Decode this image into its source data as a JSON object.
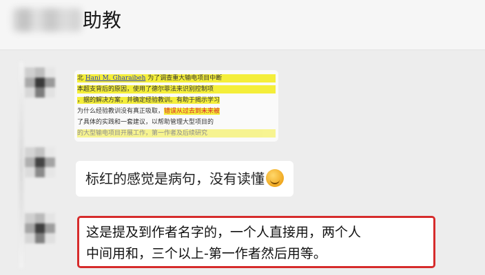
{
  "header": {
    "title_suffix": "助教"
  },
  "messages": [
    {
      "type": "image",
      "doc_lines": [
        {
          "prefix": "北",
          "author": "Hani M. Gharaibeh",
          "rest": "为了调查重大输电项目中断"
        },
        {
          "prefix": "",
          "author": "",
          "rest": "本超支背后的原因，使用了德尔菲法来识别控制项"
        },
        {
          "prefix": "",
          "author": "",
          "rest": "，据的解决方案，并确定经验教训。有助于揭示学习"
        },
        {
          "prefix": "",
          "author": "",
          "rest": "为什么经验教训没有真正吸取，",
          "red": "错误从过去到未来被"
        },
        {
          "prefix": "",
          "author": "",
          "rest": "了具体的实践和一套建议，以帮助管理大型项目的"
        },
        {
          "prefix": "",
          "author": "",
          "rest": "的大型输电项目开展工作，第一作者及后续研究"
        }
      ]
    },
    {
      "type": "text",
      "text": "标红的感觉是病句，没有读懂",
      "emoji": "sweat-smile-face-icon"
    },
    {
      "type": "text",
      "lines": [
        "这是提及到作者名字的，一个人直接用，两个人",
        "中间用和，三个以上-第一作者然后用等。"
      ],
      "highlight_color": "#d62b2b"
    }
  ]
}
